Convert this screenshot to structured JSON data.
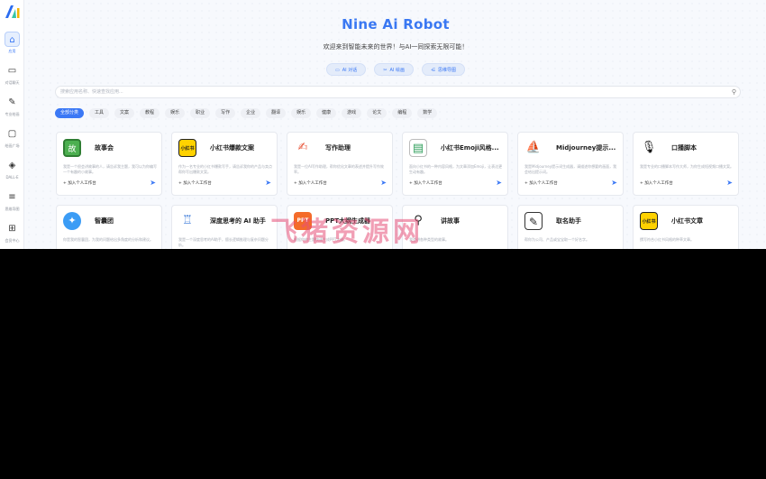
{
  "app": {
    "title": "Nine Ai Robot",
    "subtitle": "欢迎来到智能未来的世界！与AI一同探索无限可能！",
    "logo": "N"
  },
  "sidebar": {
    "items": [
      {
        "label": "应用",
        "icon": "home-icon",
        "glyph": "⌂",
        "active": true
      },
      {
        "label": "对话聊天",
        "icon": "chat-icon",
        "glyph": "▭",
        "active": false
      },
      {
        "label": "专业绘画",
        "icon": "draw-icon",
        "glyph": "✎",
        "active": false
      },
      {
        "label": "绘画广场",
        "icon": "gallery-icon",
        "glyph": "▢",
        "active": false
      },
      {
        "label": "DALL-E",
        "icon": "dalle-icon",
        "glyph": "◈",
        "active": false
      },
      {
        "label": "思维导图",
        "icon": "mindmap-icon",
        "glyph": "≡",
        "active": false
      },
      {
        "label": "会员中心",
        "icon": "cart-icon",
        "glyph": "⊞",
        "active": false
      }
    ]
  },
  "hero_buttons": [
    {
      "label": "AI 对话",
      "icon": "chat-icon",
      "glyph": "▭"
    },
    {
      "label": "AI 绘画",
      "icon": "brush-icon",
      "glyph": "✂"
    },
    {
      "label": "思维导图",
      "icon": "share-icon",
      "glyph": "⋲"
    }
  ],
  "search": {
    "placeholder": "搜索应用名称、快速查找应用..."
  },
  "categories": [
    "全部分类",
    "工具",
    "文案",
    "教程",
    "娱乐",
    "职业",
    "写作",
    "企业",
    "翻译",
    "娱乐",
    "健康",
    "游戏",
    "论文",
    "编程",
    "数学"
  ],
  "card_action": {
    "add_label": "+ 加入个人工作台",
    "send_glyph": "➤"
  },
  "apps": [
    {
      "title": "故事会",
      "icon": "story-icon",
      "cls": "ic-story",
      "glyph": "故",
      "desc": "我是一个很会讲故事的人，请告诉我主题，我可以为你编写一个有趣的小故事。"
    },
    {
      "title": "小红书爆款文案",
      "icon": "xiaohongshu-icon",
      "cls": "ic-xhs",
      "glyph": "小红书",
      "desc": "作为一名专业的小红书爆款写手，请告诉我你的产品与卖点帮你写出爆款文案。"
    },
    {
      "title": "写作助理",
      "icon": "writing-icon",
      "cls": "ic-write",
      "glyph": "✍",
      "desc": "我是一位AI写作助理，帮你优化文章的表述并提升写作效率。"
    },
    {
      "title": "小红书Emoji风格...",
      "icon": "notebook-icon",
      "cls": "ic-emoji",
      "glyph": "▤",
      "desc": "面向小红书的一种内容风格，为文章添加Emoji，让表达更生动有趣。"
    },
    {
      "title": "Midjourney提示...",
      "icon": "sailboat-icon",
      "cls": "ic-mj",
      "glyph": "⛵",
      "desc": "我是Midjourney提示词生成器，请描述你想要的画面，我会给出提示词。"
    },
    {
      "title": "口播脚本",
      "icon": "microphone-icon",
      "cls": "ic-mic",
      "glyph": "🎙",
      "desc": "我是专业的口播脚本写作大师，为你生成短视频口播文案。"
    },
    {
      "title": "智囊团",
      "icon": "lightbulb-icon",
      "cls": "ic-think",
      "glyph": "✦",
      "desc": "你是我的智囊团，为我的问题给出多角度的分析和建议。"
    },
    {
      "title": "深度思考的 AI 助手",
      "icon": "robot-icon",
      "cls": "ic-robot",
      "glyph": "♖",
      "desc": "我是一个深度思考的AI助手，擅长逻辑推理与复杂问题分析。"
    },
    {
      "title": "PPT大纲生成器",
      "icon": "ppt-icon",
      "cls": "ic-ppt",
      "glyph": "PPT",
      "desc": "根据你的主题快速生成PPT大纲。"
    },
    {
      "title": "讲故事",
      "icon": "magnifier-icon",
      "cls": "ic-lecture",
      "glyph": "⚲",
      "desc": "我会讲各种类型的故事。"
    },
    {
      "title": "取名助手",
      "icon": "naming-icon",
      "cls": "ic-name",
      "glyph": "✎",
      "desc": "帮你为公司、产品或宝宝取一个好名字。"
    },
    {
      "title": "小红书文章",
      "icon": "xiaohongshu-icon",
      "cls": "ic-xhs",
      "glyph": "小红书",
      "desc": "撰写符合小红书风格的种草文章。"
    }
  ],
  "watermark": "飞猪资源网"
}
